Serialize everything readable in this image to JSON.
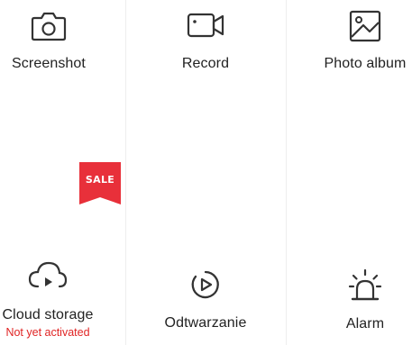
{
  "tiles": [
    {
      "label": "Screenshot",
      "icon": "camera-icon"
    },
    {
      "label": "Record",
      "icon": "video-camera-icon"
    },
    {
      "label": "Photo album",
      "icon": "image-icon"
    },
    {
      "label": "Cloud storage",
      "icon": "cloud-play-icon",
      "sublabel": "Not yet activated",
      "badge": "SALE"
    },
    {
      "label": "Odtwarzanie",
      "icon": "playback-icon"
    },
    {
      "label": "Alarm",
      "icon": "siren-icon"
    }
  ],
  "colors": {
    "icon": "#333333",
    "sale_badge": "#e8303a",
    "inactive_text": "#e02424",
    "divider": "#eeeeee"
  }
}
